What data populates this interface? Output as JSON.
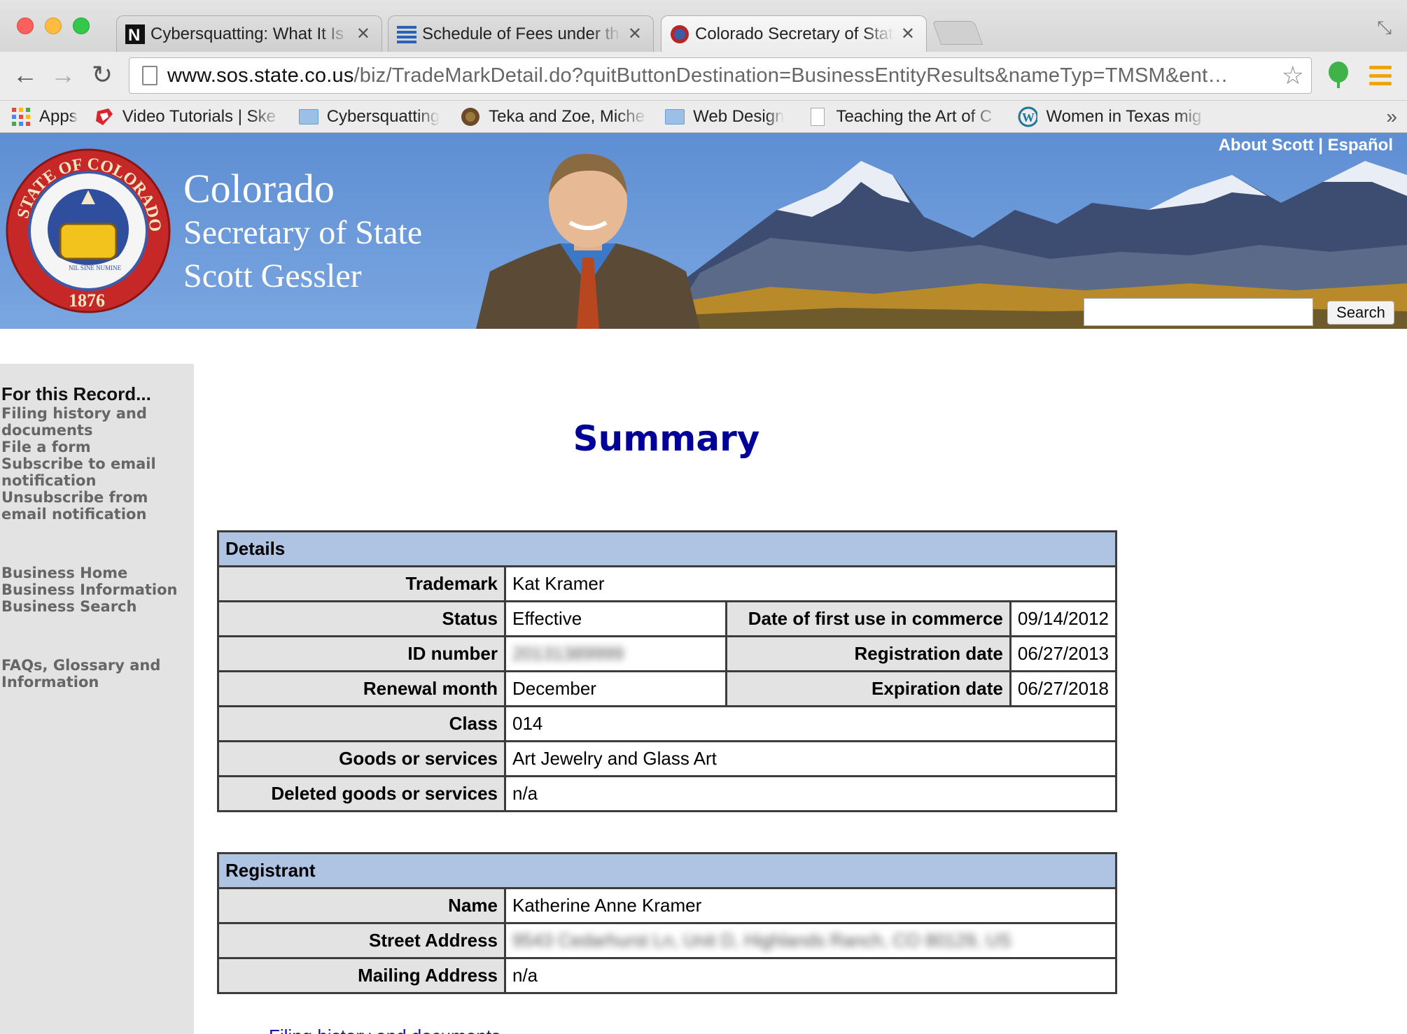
{
  "browser": {
    "tabs": [
      {
        "title": "Cybersquatting: What It Is and",
        "favicon": "n-letter-icon",
        "active": false
      },
      {
        "title": "Schedule of Fees under the",
        "favicon": "stripes-icon",
        "active": false
      },
      {
        "title": "Colorado Secretary of State",
        "favicon": "colorado-seal-icon",
        "active": true
      }
    ],
    "close_glyph": "✕",
    "url_host": "www.sos.state.co.us",
    "url_path": "/biz/TradeMarkDetail.do?quitButtonDestination=BusinessEntityResults&nameTyp=TMSM&ent…",
    "bookmarks": [
      {
        "label": "Apps",
        "icon": "apps-grid-icon"
      },
      {
        "label": "Video Tutorials | Ske",
        "icon": "sketchup-icon"
      },
      {
        "label": "Cybersquatting",
        "icon": "folder-icon"
      },
      {
        "label": "Teka and Zoe, Miche",
        "icon": "site-icon"
      },
      {
        "label": "Web Design",
        "icon": "folder-icon"
      },
      {
        "label": "Teaching the Art of C",
        "icon": "page-icon"
      },
      {
        "label": "Women in Texas mig",
        "icon": "wordpress-icon"
      }
    ],
    "more_glyph": "»"
  },
  "header": {
    "line1": "Colorado",
    "line2": "Secretary of State",
    "line3": "Scott Gessler",
    "seal_text_top": "STATE OF COLORADO",
    "seal_year": "1876",
    "seal_motto": "NIL SINE NUMINE",
    "link_about": "About Scott",
    "link_sep": "|",
    "link_lang": "Español",
    "search_button": "Search"
  },
  "sidebar": {
    "heading": "For this Record...",
    "record_links": [
      "Filing history and documents",
      "File a form",
      "Subscribe to email notification",
      "Unsubscribe from email notification"
    ],
    "business_links": [
      "Business Home",
      "Business Information",
      "Business Search"
    ],
    "info_links": [
      "FAQs, Glossary and Information"
    ]
  },
  "main": {
    "title": "Summary",
    "details": {
      "heading": "Details",
      "trademark_label": "Trademark",
      "trademark": "Kat Kramer",
      "status_label": "Status",
      "status": "Effective",
      "first_use_label": "Date of first use in commerce",
      "first_use": "09/14/2012",
      "id_label": "ID number",
      "id": "20131389999",
      "reg_date_label": "Registration date",
      "reg_date": "06/27/2013",
      "renewal_label": "Renewal month",
      "renewal": "December",
      "exp_label": "Expiration date",
      "exp": "06/27/2018",
      "class_label": "Class",
      "class": "014",
      "goods_label": "Goods or services",
      "goods": "Art Jewelry and Glass Art",
      "deleted_label": "Deleted goods or services",
      "deleted": "n/a"
    },
    "registrant": {
      "heading": "Registrant",
      "name_label": "Name",
      "name": "Katherine Anne Kramer",
      "street_label": "Street Address",
      "street": "9543 Cedarhurst Ln, Unit D, Highlands Ranch, CO 80129, US",
      "mailing_label": "Mailing Address",
      "mailing": "n/a"
    },
    "bottom_link": "Filing history and documents"
  }
}
